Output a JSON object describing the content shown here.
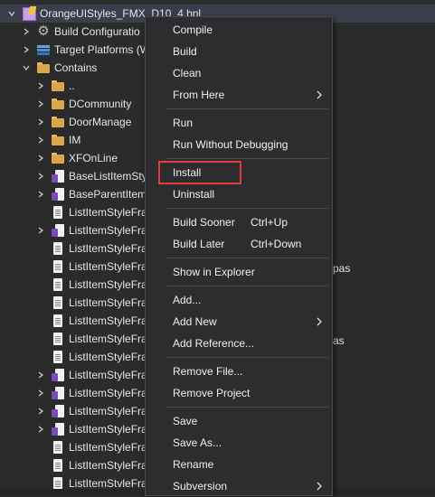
{
  "tree": {
    "root_label": "OrangeUIStyles_FMX_D10_4.bpl",
    "build_configurations": "Build Configuratio",
    "target_platforms": "Target Platforms (W",
    "contains": "Contains",
    "folders": [
      "..",
      "DCommunity",
      "DoorManage",
      "IM",
      "XFOnLine"
    ],
    "items": [
      {
        "label": "BaseListItemSty",
        "icon": "unit-form-icon",
        "expand": true
      },
      {
        "label": "BaseParentItem",
        "icon": "unit-form-icon",
        "expand": true
      },
      {
        "label": "ListItemStyleFra",
        "icon": "file-icon",
        "expand": false
      },
      {
        "label": "ListItemStyleFra",
        "icon": "unit-form-icon",
        "expand": true
      },
      {
        "label": "ListItemStyleFra",
        "icon": "file-icon",
        "expand": false
      },
      {
        "label": "ListItemStyleFra",
        "icon": "file-icon",
        "expand": false
      },
      {
        "label": "ListItemStyleFra",
        "icon": "file-icon",
        "expand": false
      },
      {
        "label": "ListItemStyleFra",
        "icon": "file-icon",
        "expand": false
      },
      {
        "label": "ListItemStyleFra",
        "icon": "file-icon",
        "expand": false
      },
      {
        "label": "ListItemStyleFra",
        "icon": "file-icon",
        "expand": false
      },
      {
        "label": "ListItemStyleFra",
        "icon": "file-icon",
        "expand": false
      },
      {
        "label": "ListItemStyleFra",
        "icon": "unit-form-icon",
        "expand": true
      },
      {
        "label": "ListItemStyleFra",
        "icon": "unit-form-icon",
        "expand": true
      },
      {
        "label": "ListItemStyleFra",
        "icon": "unit-form-icon",
        "expand": true
      },
      {
        "label": "ListItemStyleFra",
        "icon": "unit-form-icon",
        "expand": true
      },
      {
        "label": "ListItemStyleFra",
        "icon": "file-icon",
        "expand": false
      },
      {
        "label": "ListItemStyleFra",
        "icon": "file-icon",
        "expand": false
      },
      {
        "label": "ListItemStvleFra",
        "icon": "file-icon",
        "expand": false
      }
    ],
    "overflow_right_1": "pas",
    "overflow_right_2": "as"
  },
  "menu": {
    "compile": "Compile",
    "build": "Build",
    "clean": "Clean",
    "from_here": "From Here",
    "run": "Run",
    "run_without_debugging": "Run Without Debugging",
    "install": "Install",
    "uninstall": "Uninstall",
    "build_sooner": "Build Sooner",
    "build_sooner_shortcut": "Ctrl+Up",
    "build_later": "Build Later",
    "build_later_shortcut": "Ctrl+Down",
    "show_in_explorer": "Show in Explorer",
    "add": "Add...",
    "add_new": "Add New",
    "add_reference": "Add Reference...",
    "remove_file": "Remove File...",
    "remove_project": "Remove Project",
    "save": "Save",
    "save_as": "Save As...",
    "rename": "Rename",
    "subversion": "Subversion"
  },
  "colors": {
    "background": "#2b2b2b",
    "menu_background": "#2d2d30",
    "highlight_box": "#e03c3c",
    "folder": "#d9a74a",
    "unit_form_badge": "#7a4bb5"
  }
}
